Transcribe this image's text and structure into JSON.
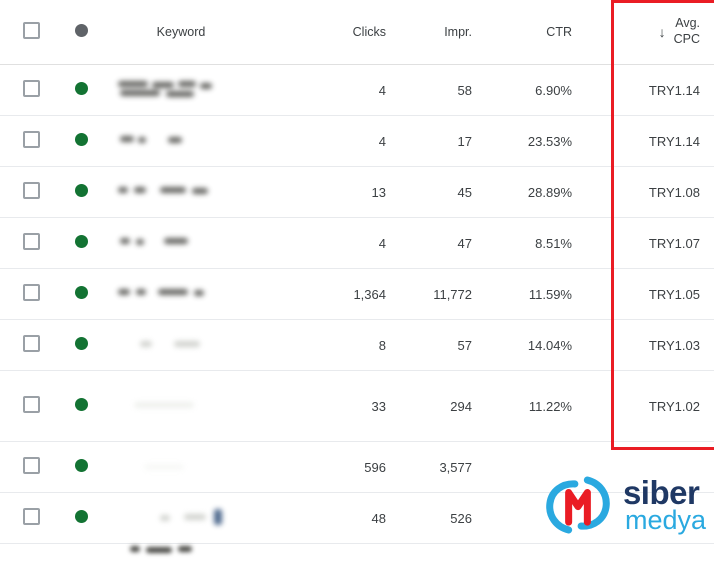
{
  "table": {
    "columns": {
      "checkbox": "",
      "status": "",
      "keyword": "Keyword",
      "gap": "",
      "clicks": "Clicks",
      "impr": "Impr.",
      "ctr": "CTR",
      "avg_cpc_line1": "Avg.",
      "avg_cpc_line2": "CPC",
      "sort_arrow": "↓"
    },
    "rows": [
      {
        "status": "green",
        "keyword": "",
        "clicks": "4",
        "impr": "58",
        "ctr": "6.90%",
        "avg_cpc": "TRY1.14"
      },
      {
        "status": "green",
        "keyword": "",
        "clicks": "4",
        "impr": "17",
        "ctr": "23.53%",
        "avg_cpc": "TRY1.14"
      },
      {
        "status": "green",
        "keyword": "",
        "clicks": "13",
        "impr": "45",
        "ctr": "28.89%",
        "avg_cpc": "TRY1.08"
      },
      {
        "status": "green",
        "keyword": "",
        "clicks": "4",
        "impr": "47",
        "ctr": "8.51%",
        "avg_cpc": "TRY1.07"
      },
      {
        "status": "green",
        "keyword": "",
        "clicks": "1,364",
        "impr": "11,772",
        "ctr": "11.59%",
        "avg_cpc": "TRY1.05"
      },
      {
        "status": "green",
        "keyword": "",
        "clicks": "8",
        "impr": "57",
        "ctr": "14.04%",
        "avg_cpc": "TRY1.03"
      },
      {
        "status": "green",
        "keyword": "",
        "clicks": "33",
        "impr": "294",
        "ctr": "11.22%",
        "avg_cpc": "TRY1.02"
      },
      {
        "status": "green",
        "keyword": "",
        "clicks": "596",
        "impr": "3,577",
        "ctr": "",
        "avg_cpc": ""
      },
      {
        "status": "green",
        "keyword": "",
        "clicks": "48",
        "impr": "526",
        "ctr": "",
        "avg_cpc": ""
      }
    ]
  },
  "highlight": {
    "color": "#ea1c24",
    "target_column": "Avg. CPC"
  },
  "watermark": {
    "brand_primary": "siber",
    "brand_secondary": "medya",
    "color_primary": "#1f3864",
    "color_secondary": "#2aa9e0"
  }
}
